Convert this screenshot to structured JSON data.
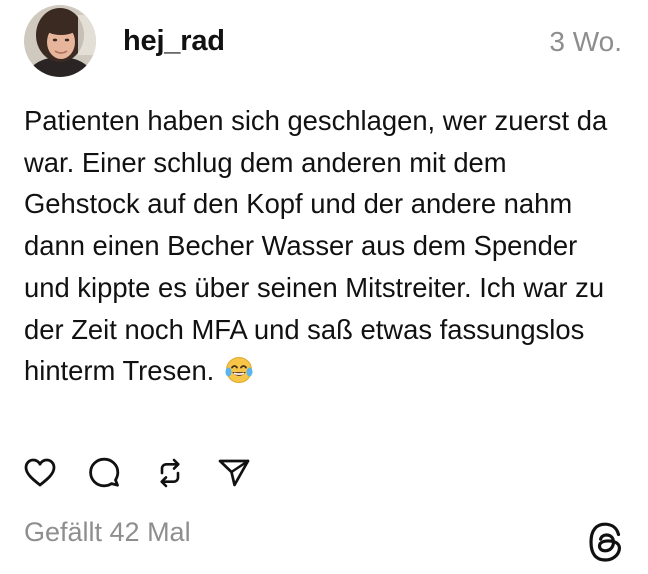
{
  "post": {
    "username": "hej_rad",
    "timestamp": "3 Wo.",
    "text": "Patienten haben sich geschlagen, wer zuerst da war. Einer schlug dem anderen mit dem Gehstock auf den Kopf und der andere nahm dann einen Becher Wasser aus dem Spender und kippte es über seinen Mitstreiter. Ich war zu der Zeit noch MFA und saß etwas fassungslos hinterm Tresen.",
    "emoji": "face-with-tears-of-joy",
    "likes": "Gefällt 42 Mal"
  },
  "actions": {
    "like": "heart-icon",
    "comment": "comment-icon",
    "repost": "repost-icon",
    "share": "send-icon"
  },
  "branding": {
    "logo": "threads-logo-icon"
  },
  "colors": {
    "text": "#111111",
    "muted": "#8e8e8e",
    "background": "#ffffff"
  }
}
